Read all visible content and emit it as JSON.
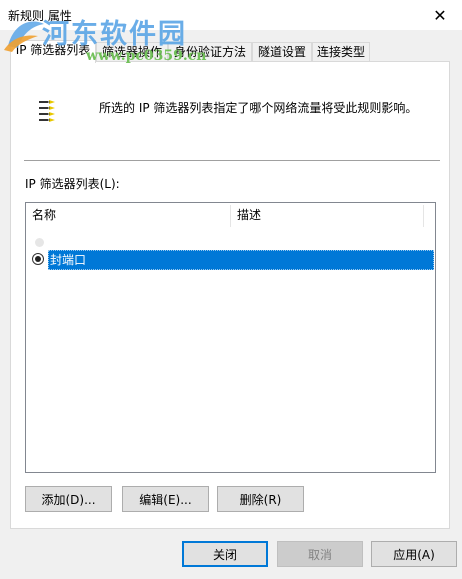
{
  "window": {
    "title": "新规则 属性",
    "close_glyph": "✕"
  },
  "watermark": {
    "text": "河东软件园",
    "url": "www.pc0359.cn",
    "colors": {
      "main": "#5aa5e6",
      "url": "#72c15a"
    }
  },
  "tabs": [
    {
      "label": "IP 筛选器列表",
      "active": true
    },
    {
      "label": "筛选器操作",
      "active": false
    },
    {
      "label": "身份验证方法",
      "active": false
    },
    {
      "label": "隧道设置",
      "active": false
    },
    {
      "label": "连接类型",
      "active": false
    }
  ],
  "panel": {
    "description": "所选的 IP 筛选器列表指定了哪个网络流量将受此规则影响。",
    "list_label": "IP 筛选器列表(L):",
    "columns": {
      "name": "名称",
      "description": "描述"
    },
    "rows": [
      {
        "name": "封端口",
        "description": "",
        "selected": true,
        "radio_checked": true
      }
    ],
    "buttons": {
      "add": "添加(D)...",
      "edit": "编辑(E)...",
      "delete": "删除(R)"
    }
  },
  "footer": {
    "close": "关闭",
    "cancel": "取消",
    "apply": "应用(A)"
  },
  "colors": {
    "selection": "#0078d7",
    "focus_border": "#0078d7"
  },
  "icons": {
    "filter_list": "ip-filter-list-icon"
  }
}
